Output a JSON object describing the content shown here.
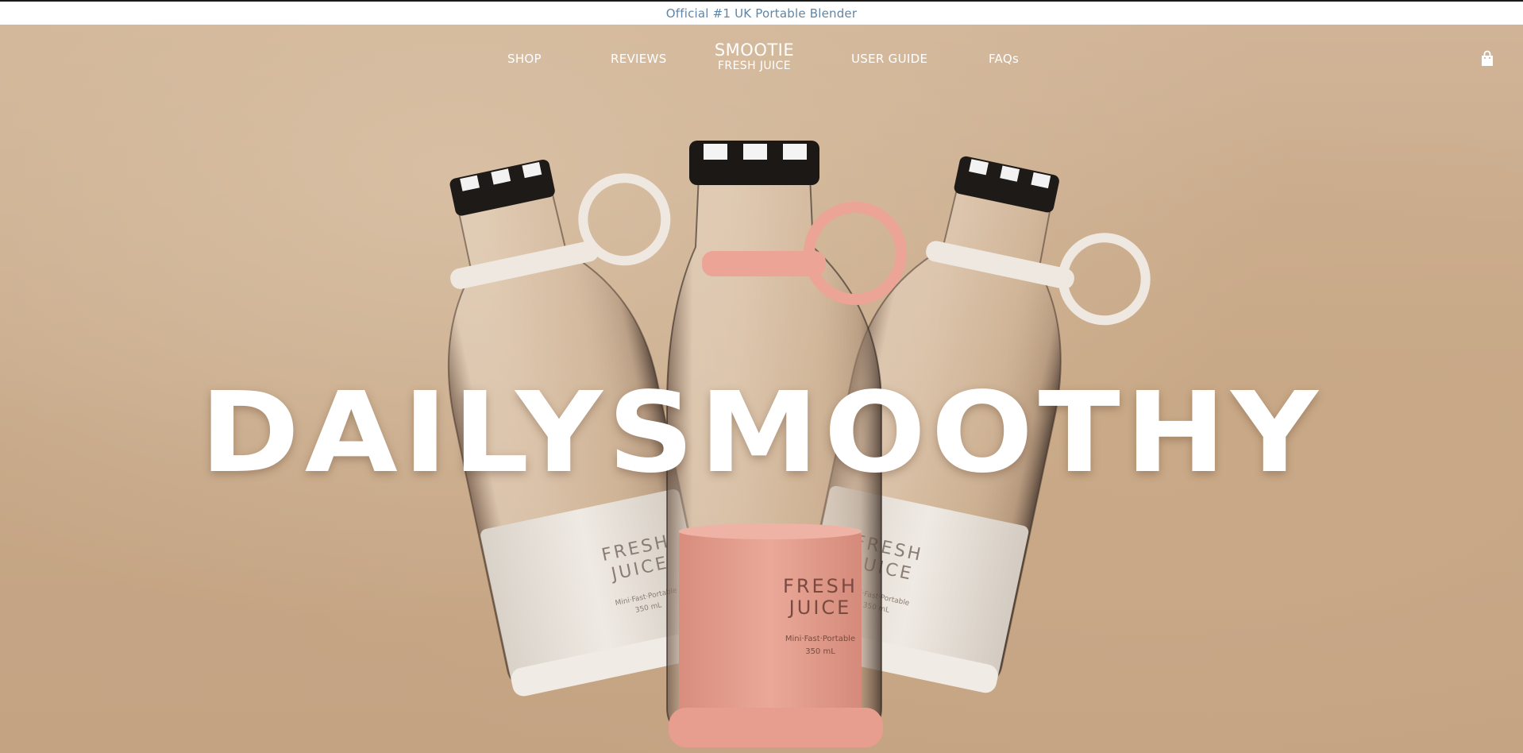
{
  "announcement": {
    "text": "Official #1 UK Portable Blender"
  },
  "nav": {
    "items": [
      {
        "label": "SHOP"
      },
      {
        "label": "REVIEWS"
      },
      {
        "label": "USER GUIDE"
      },
      {
        "label": "FAQs"
      }
    ],
    "logo": {
      "line1": "SMOOTIE",
      "line2": "FRESH JUICE"
    },
    "cart_icon": "shopping-bag-icon"
  },
  "hero": {
    "headline": "DAILYSMOOTHY",
    "bottle_labels": [
      {
        "line1": "FRESH",
        "line2": "JUICE",
        "sub": "Mini·Fast·Portable",
        "volume": "350 mL"
      },
      {
        "line1": "FRESH",
        "line2": "JUICE",
        "sub": "Mini·Fast·Portable",
        "volume": "350 mL"
      },
      {
        "line1": "FRESH",
        "line2": "JUICE",
        "sub": "Mini·Fast·Portable",
        "volume": "350 mL"
      }
    ]
  },
  "colors": {
    "announcement_text": "#5f86a8",
    "background": "#c8ab8c",
    "pink": "#e9a393",
    "cream": "#ece6df"
  }
}
